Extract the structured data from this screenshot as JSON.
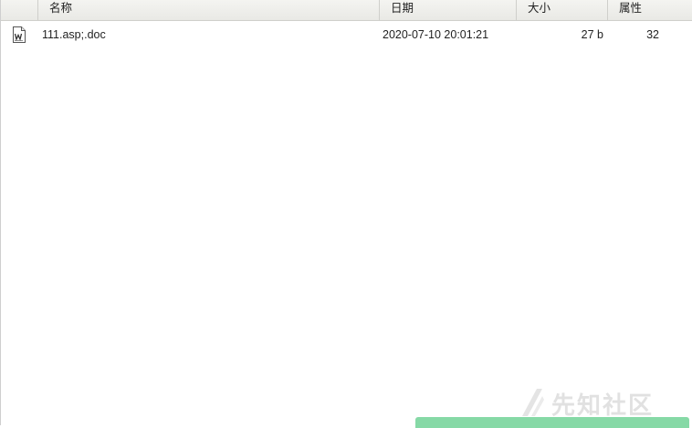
{
  "header": {
    "columns": [
      "名称",
      "日期",
      "大小",
      "属性"
    ]
  },
  "files": [
    {
      "icon": "word-document-icon",
      "name": "111.asp;.doc",
      "date": "2020-07-10 20:01:21",
      "size": "27 b",
      "attr": "32"
    }
  ],
  "watermark": {
    "text": "先知社区"
  },
  "colors": {
    "header_bg": "#ecece8",
    "toast_green": "#86d9a6"
  }
}
